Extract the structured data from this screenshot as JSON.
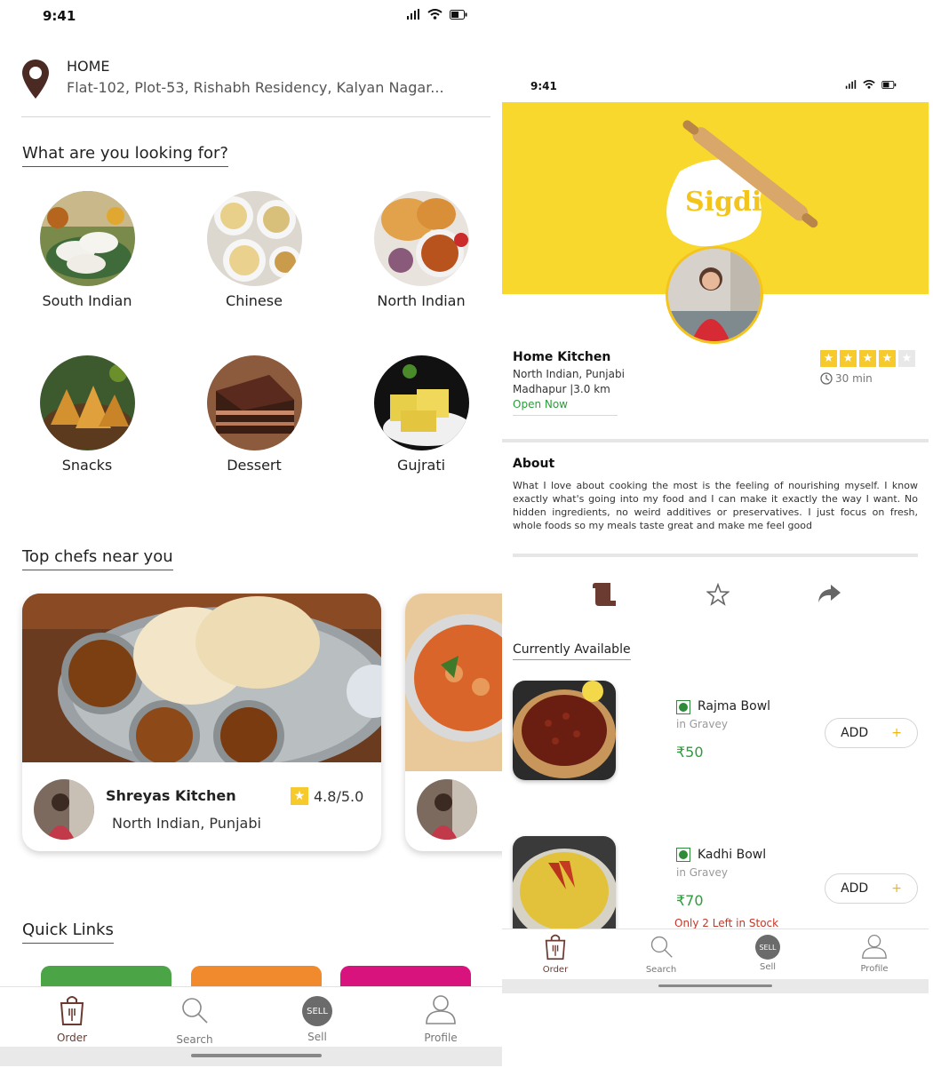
{
  "left_screen": {
    "status_time": "9:41",
    "address": {
      "label": "HOME",
      "text": "Flat-102, Plot-53, Rishabh Residency, Kalyan Nagar..."
    },
    "looking_for_title": "What are you looking for?",
    "categories": [
      {
        "label": "South Indian"
      },
      {
        "label": "Chinese"
      },
      {
        "label": "North Indian"
      },
      {
        "label": "Snacks"
      },
      {
        "label": "Dessert"
      },
      {
        "label": "Gujrati"
      }
    ],
    "top_chefs_title": "Top chefs near you",
    "chefs": [
      {
        "name": "Shreyas Kitchen",
        "cuisine": "North Indian, Punjabi",
        "rating": "4.8/5.0"
      }
    ],
    "quick_links_title": "Quick Links",
    "quick_link_colors": [
      "#4ba446",
      "#f08a2c",
      "#d8137e"
    ],
    "nav": [
      {
        "label": "Order",
        "icon": "shopping-bag-icon"
      },
      {
        "label": "Search",
        "icon": "search-icon"
      },
      {
        "label": "Sell",
        "icon": "sell-badge-icon",
        "badge": "SELL"
      },
      {
        "label": "Profile",
        "icon": "profile-icon"
      }
    ]
  },
  "right_screen": {
    "status_time": "9:41",
    "brand": "Sigdi",
    "kitchen": {
      "name": "Home Kitchen",
      "cuisine": "North Indian, Punjabi",
      "location": "Madhapur |3.0 km",
      "status": "Open Now",
      "rating_stars": 4,
      "rating_max": 5,
      "eta": "30 min"
    },
    "about": {
      "title": "About",
      "text": "What I love about cooking the most is the feeling of nourishing myself. I know exactly what's going into my food and I can make it exactly the way I want. No hidden ingredients, no weird additives or preservatives. I just focus on fresh, whole foods so my meals taste great and make me feel good"
    },
    "actions": [
      {
        "icon": "menu-scroll-icon"
      },
      {
        "icon": "star-outline-icon"
      },
      {
        "icon": "share-arrow-icon"
      }
    ],
    "available_title": "Currently Available",
    "dishes": [
      {
        "name": "Rajma Bowl",
        "sub": "in Gravey",
        "price": "₹50",
        "button": "ADD",
        "stock": ""
      },
      {
        "name": "Kadhi Bowl",
        "sub": "in Gravey",
        "price": "₹70",
        "button": "ADD",
        "stock": "Only 2 Left in Stock"
      }
    ],
    "nav": [
      {
        "label": "Order",
        "icon": "shopping-bag-icon"
      },
      {
        "label": "Search",
        "icon": "search-icon"
      },
      {
        "label": "Sell",
        "icon": "sell-badge-icon",
        "badge": "SELL"
      },
      {
        "label": "Profile",
        "icon": "profile-icon"
      }
    ]
  },
  "colors": {
    "accent_brown": "#6b3a30",
    "banner_yellow": "#f9d82d",
    "star_yellow": "#f6c92d",
    "open_green": "#2e9b3c",
    "stock_red": "#c0392b"
  }
}
